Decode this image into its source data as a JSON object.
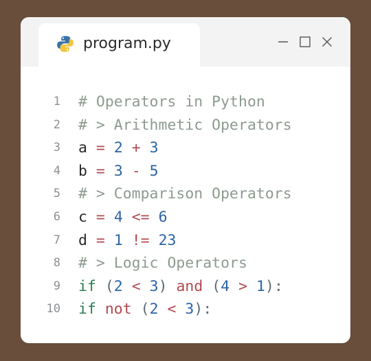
{
  "window": {
    "tab": {
      "title": "program.py",
      "icon": "python-icon"
    },
    "controls": [
      "minimize-icon",
      "maximize-icon",
      "close-icon"
    ]
  },
  "colors": {
    "background": "#684e3b",
    "window": "#ffffff",
    "titlebar": "#f3f3f3",
    "comment": "#8d9a8f",
    "operator": "#b2484f",
    "number": "#2b63a3",
    "keyword": "#2e7c55",
    "identifier": "#2a2a2a",
    "punctuation": "#5c6a74",
    "line_number": "#8b8f92"
  },
  "editor": {
    "lines": [
      {
        "number": "1",
        "tokens": [
          {
            "text": "# Operators in Python",
            "type": "comment"
          }
        ]
      },
      {
        "number": "2",
        "tokens": [
          {
            "text": "# > Arithmetic Operators",
            "type": "comment"
          }
        ]
      },
      {
        "number": "3",
        "tokens": [
          {
            "text": "a",
            "type": "ident"
          },
          {
            "text": " ",
            "type": "space"
          },
          {
            "text": "=",
            "type": "op"
          },
          {
            "text": " ",
            "type": "space"
          },
          {
            "text": "2",
            "type": "num"
          },
          {
            "text": " ",
            "type": "space"
          },
          {
            "text": "+",
            "type": "op"
          },
          {
            "text": " ",
            "type": "space"
          },
          {
            "text": "3",
            "type": "num"
          }
        ]
      },
      {
        "number": "4",
        "tokens": [
          {
            "text": "b",
            "type": "ident"
          },
          {
            "text": " ",
            "type": "space"
          },
          {
            "text": "=",
            "type": "op"
          },
          {
            "text": " ",
            "type": "space"
          },
          {
            "text": "3",
            "type": "num"
          },
          {
            "text": " ",
            "type": "space"
          },
          {
            "text": "-",
            "type": "op"
          },
          {
            "text": " ",
            "type": "space"
          },
          {
            "text": "5",
            "type": "num"
          }
        ]
      },
      {
        "number": "5",
        "tokens": [
          {
            "text": "# > Comparison Operators",
            "type": "comment"
          }
        ]
      },
      {
        "number": "6",
        "tokens": [
          {
            "text": "c",
            "type": "ident"
          },
          {
            "text": " ",
            "type": "space"
          },
          {
            "text": "=",
            "type": "op"
          },
          {
            "text": " ",
            "type": "space"
          },
          {
            "text": "4",
            "type": "num"
          },
          {
            "text": " ",
            "type": "space"
          },
          {
            "text": "<=",
            "type": "op"
          },
          {
            "text": " ",
            "type": "space"
          },
          {
            "text": "6",
            "type": "num"
          }
        ]
      },
      {
        "number": "7",
        "tokens": [
          {
            "text": "d",
            "type": "ident"
          },
          {
            "text": " ",
            "type": "space"
          },
          {
            "text": "=",
            "type": "op"
          },
          {
            "text": " ",
            "type": "space"
          },
          {
            "text": "1",
            "type": "num"
          },
          {
            "text": " ",
            "type": "space"
          },
          {
            "text": "!=",
            "type": "op"
          },
          {
            "text": " ",
            "type": "space"
          },
          {
            "text": "23",
            "type": "num"
          }
        ]
      },
      {
        "number": "8",
        "tokens": [
          {
            "text": "# > Logic Operators",
            "type": "comment"
          }
        ]
      },
      {
        "number": "9",
        "tokens": [
          {
            "text": "if",
            "type": "kw"
          },
          {
            "text": " ",
            "type": "space"
          },
          {
            "text": "(",
            "type": "punc"
          },
          {
            "text": "2",
            "type": "num"
          },
          {
            "text": " ",
            "type": "space"
          },
          {
            "text": "<",
            "type": "op"
          },
          {
            "text": " ",
            "type": "space"
          },
          {
            "text": "3",
            "type": "num"
          },
          {
            "text": ")",
            "type": "punc"
          },
          {
            "text": " ",
            "type": "space"
          },
          {
            "text": "and",
            "type": "op"
          },
          {
            "text": " ",
            "type": "space"
          },
          {
            "text": "(",
            "type": "punc"
          },
          {
            "text": "4",
            "type": "num"
          },
          {
            "text": " ",
            "type": "space"
          },
          {
            "text": ">",
            "type": "op"
          },
          {
            "text": " ",
            "type": "space"
          },
          {
            "text": "1",
            "type": "num"
          },
          {
            "text": ")",
            "type": "punc"
          },
          {
            "text": ":",
            "type": "punc"
          }
        ]
      },
      {
        "number": "10",
        "tokens": [
          {
            "text": "if",
            "type": "kw"
          },
          {
            "text": " ",
            "type": "space"
          },
          {
            "text": "not",
            "type": "op"
          },
          {
            "text": " ",
            "type": "space"
          },
          {
            "text": "(",
            "type": "punc"
          },
          {
            "text": "2",
            "type": "num"
          },
          {
            "text": " ",
            "type": "space"
          },
          {
            "text": "<",
            "type": "op"
          },
          {
            "text": " ",
            "type": "space"
          },
          {
            "text": "3",
            "type": "num"
          },
          {
            "text": ")",
            "type": "punc"
          },
          {
            "text": ":",
            "type": "punc"
          }
        ]
      }
    ]
  }
}
